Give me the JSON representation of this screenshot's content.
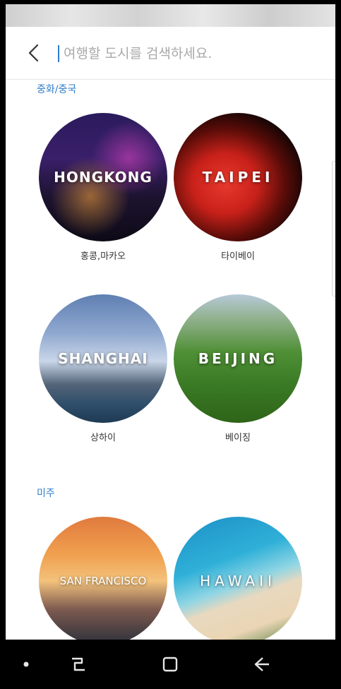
{
  "search": {
    "placeholder": "여행할 도시를 검색하세요."
  },
  "sections": [
    {
      "title": "중화/중국",
      "cities": [
        {
          "label": "HONGKONG",
          "name": "홍콩,마카오"
        },
        {
          "label": "TAIPEI",
          "name": "타이베이"
        },
        {
          "label": "SHANGHAI",
          "name": "상하이"
        },
        {
          "label": "BEIJING",
          "name": "베이징"
        }
      ]
    },
    {
      "title": "미주",
      "cities": [
        {
          "label": "SAN FRANCISCO",
          "name": ""
        },
        {
          "label": "HAWAII",
          "name": ""
        }
      ]
    }
  ],
  "icons": {
    "back": "back-arrow-icon",
    "nav_dot": "navigation-dot-icon",
    "recents": "recent-apps-icon",
    "home": "home-icon",
    "nav_back": "nav-back-icon"
  },
  "colors": {
    "accent": "#2f7cc8",
    "cursor": "#2d7fd0"
  }
}
